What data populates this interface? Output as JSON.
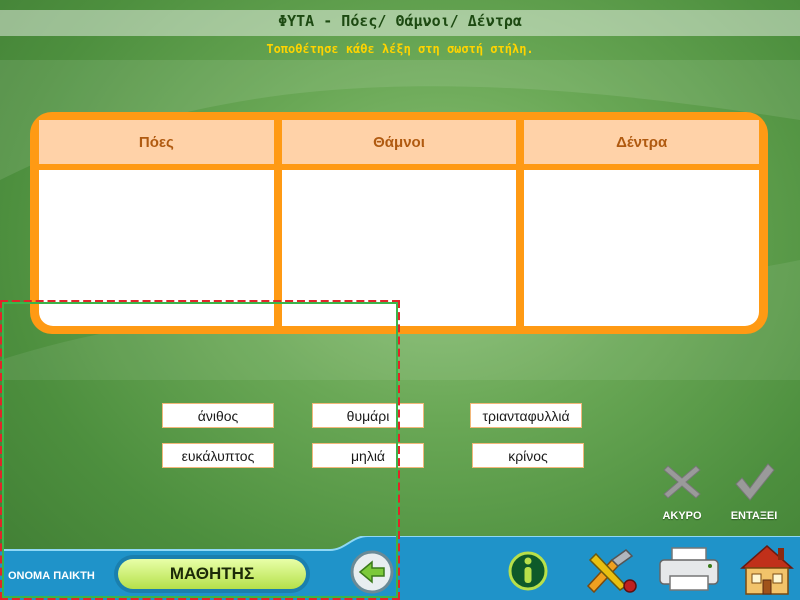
{
  "header": {
    "title": "ΦΥΤΑ - Πόες/ Θάμνοι/ Δέντρα",
    "subtitle": "Τοποθέτησε κάθε λέξη στη σωστή στήλη."
  },
  "table": {
    "columns": [
      "Πόες",
      "Θάμνοι",
      "Δέντρα"
    ]
  },
  "words": [
    "άνιθος",
    "θυμάρι",
    "τριανταφυλλιά",
    "ευκάλυπτος",
    "μηλιά",
    "κρίνος"
  ],
  "actions": {
    "cancel_label": "ΑΚΥΡΟ",
    "ok_label": "ΕΝΤΑΞΕΙ"
  },
  "footer": {
    "player_label": "ΟΝΟΜΑ ΠΑΙΚΤΗ",
    "player_name": "ΜΑΘΗΤΗΣ",
    "icons": [
      "back-arrow-icon",
      "info-icon",
      "tools-icon",
      "printer-icon",
      "home-icon"
    ]
  },
  "colors": {
    "board": "#ff9a14",
    "column_header": "#ffd2a8",
    "background_green": "#6aa856",
    "footer_blue": "#1f93c9",
    "subtitle": "#ffd400"
  }
}
